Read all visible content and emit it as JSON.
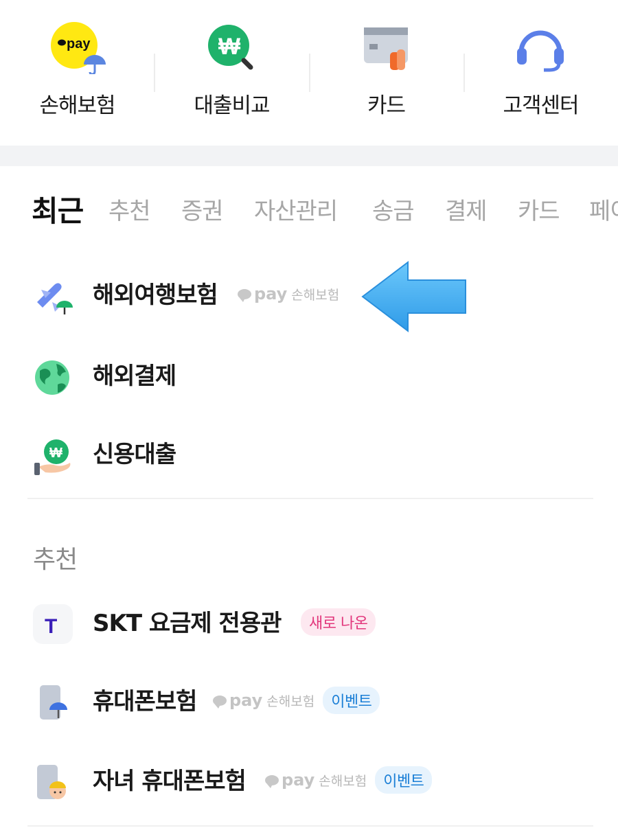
{
  "quick_menu": [
    {
      "label": "손해보험",
      "icon": "kakaopay-insurance-icon",
      "logo_text": "pay"
    },
    {
      "label": "대출비교",
      "icon": "won-search-icon",
      "logo_text": "₩"
    },
    {
      "label": "카드",
      "icon": "card-icon"
    },
    {
      "label": "고객센터",
      "icon": "headset-icon"
    }
  ],
  "tabs": [
    "최근",
    "추천",
    "증권",
    "자산관리",
    "송금",
    "결제",
    "카드",
    "페이"
  ],
  "recent": [
    {
      "title": "해외여행보험",
      "icon": "airplane-umbrella-icon",
      "pay": "pay",
      "pay_sub": "손해보험"
    },
    {
      "title": "해외결제",
      "icon": "globe-icon"
    },
    {
      "title": "신용대출",
      "icon": "hand-won-coin-icon",
      "coin_text": "₩"
    }
  ],
  "recommend": {
    "title": "추천",
    "items": [
      {
        "title": "SKT 요금제 전용관",
        "icon": "skt-logo-icon",
        "logo_text": "T",
        "badge": "새로 나온",
        "badge_type": "new"
      },
      {
        "title": "휴대폰보험",
        "icon": "phone-umbrella-icon",
        "pay": "pay",
        "pay_sub": "손해보험",
        "badge": "이벤트",
        "badge_type": "event"
      },
      {
        "title": "자녀 휴대폰보험",
        "icon": "phone-kid-icon",
        "pay": "pay",
        "pay_sub": "손해보험",
        "badge": "이벤트",
        "badge_type": "event"
      }
    ]
  },
  "colors": {
    "kakao_yellow": "#ffe812",
    "green": "#1fb26b",
    "blue_arrow": "#3aaaf5",
    "badge_new_bg": "#fde8f0",
    "badge_new_text": "#e2377c",
    "badge_event_bg": "#e7f3fd",
    "badge_event_text": "#1b7fd6"
  }
}
